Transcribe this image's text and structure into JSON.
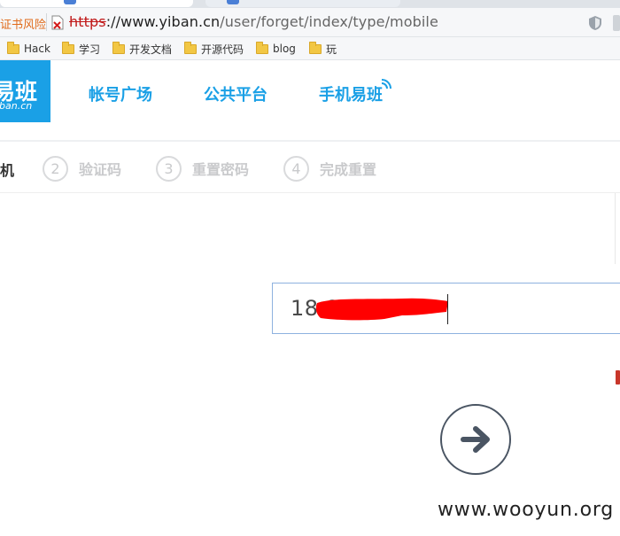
{
  "browser": {
    "cert_warning": "证书风险",
    "url": {
      "protocol": "https",
      "separator": "://",
      "host": "www.yiban.cn",
      "path": "/user/forget/index/type/mobile"
    }
  },
  "bookmarks": [
    {
      "label": "Hack"
    },
    {
      "label": "学习"
    },
    {
      "label": "开发文档"
    },
    {
      "label": "开源代码"
    },
    {
      "label": "blog"
    },
    {
      "label": "玩"
    }
  ],
  "site": {
    "logo_cn": "易班",
    "logo_en": "iban.cn",
    "brand_color": "#1aa0e6",
    "nav": [
      {
        "label": "帐号广场"
      },
      {
        "label": "公共平台"
      },
      {
        "label": "手机易班"
      }
    ]
  },
  "steps": {
    "current_label_fragment": "机",
    "items": [
      {
        "num": "2",
        "label": "验证码"
      },
      {
        "num": "3",
        "label": "重置密码"
      },
      {
        "num": "4",
        "label": "完成重置"
      }
    ]
  },
  "form": {
    "phone_value": "18        88",
    "next_icon": "arrow-right-icon"
  },
  "watermark": "www.wooyun.org"
}
